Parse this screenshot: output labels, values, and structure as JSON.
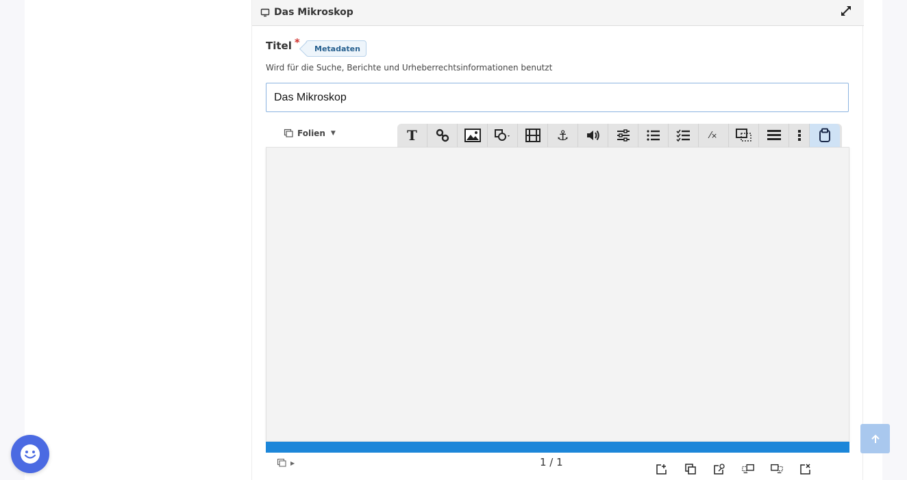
{
  "panel": {
    "title": "Das Mikroskop",
    "title_icon": "slides-icon",
    "expand_icon": "expand-icon"
  },
  "field": {
    "label": "Titel",
    "required_marker": "*",
    "metadata_tag": "Metadaten",
    "description": "Wird für die Suche, Berichte und Urheberrechtsinformationen benutzt",
    "value": "Das Mikroskop"
  },
  "editor": {
    "slides_menu_label": "Folien",
    "toolbar_icons": [
      "text-icon",
      "link-icon",
      "image-icon",
      "shape-icon",
      "video-icon",
      "anchor-icon",
      "audio-icon",
      "settings-sliders-icon",
      "ordered-list-icon",
      "checklist-icon",
      "percentage-icon",
      "overlay-icon",
      "lines-icon",
      "more-icon",
      "clipboard-icon"
    ],
    "active_toolbar_icon": "clipboard-icon",
    "page_counter": "1 / 1",
    "progress": 1.0,
    "accent_color": "#1c86d9",
    "footer_actions": [
      "add-slide-icon",
      "clone-slide-icon",
      "export-slide-icon",
      "move-slide-left-icon",
      "move-slide-right-icon",
      "delete-slide-icon"
    ]
  },
  "scroll_top_icon": "arrow-up-icon",
  "feedback_icon": "smiley-icon"
}
